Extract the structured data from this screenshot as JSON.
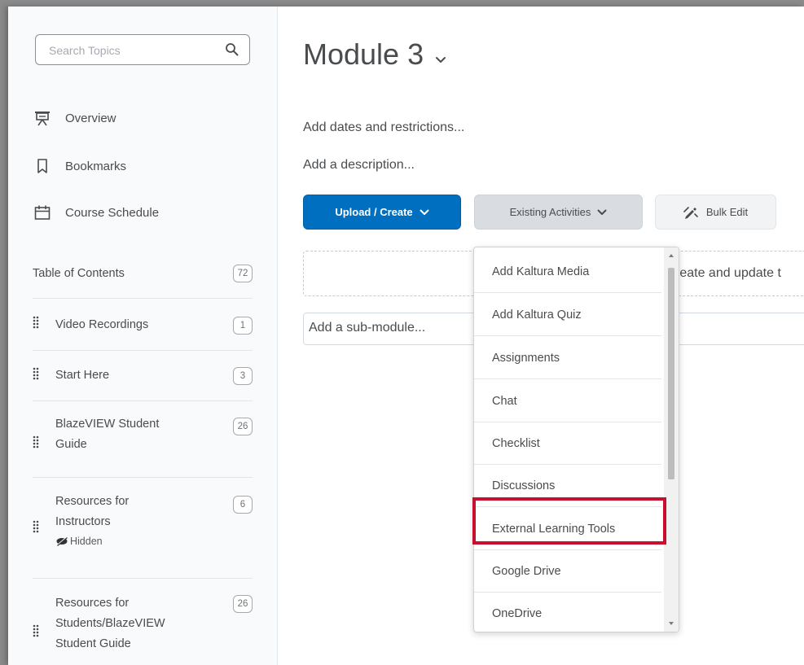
{
  "sidebar": {
    "search_placeholder": "Search Topics",
    "nav": [
      {
        "label": "Overview",
        "icon": "presentation-icon"
      },
      {
        "label": "Bookmarks",
        "icon": "bookmark-icon"
      },
      {
        "label": "Course Schedule",
        "icon": "calendar-icon"
      }
    ],
    "toc": {
      "label": "Table of Contents",
      "count": "72"
    },
    "modules": [
      {
        "lines": [
          "Video Recordings"
        ],
        "count": "1"
      },
      {
        "lines": [
          "Start Here"
        ],
        "count": "3"
      },
      {
        "lines": [
          "BlazeVIEW Student",
          "Guide"
        ],
        "count": "26"
      },
      {
        "lines": [
          "Resources for",
          "Instructors"
        ],
        "count": "6",
        "hidden_label": "Hidden"
      },
      {
        "lines": [
          "Resources for",
          "Students/BlazeVIEW",
          "Student Guide"
        ],
        "count": "26"
      }
    ]
  },
  "main": {
    "title": "Module 3",
    "add_dates": "Add dates and restrictions...",
    "add_description": "Add a description...",
    "buttons": {
      "upload": "Upload / Create",
      "existing": "Existing Activities",
      "bulk": "Bulk Edit"
    },
    "dropzone_text": "reate and update t",
    "submodule_placeholder": "Add a sub-module..."
  },
  "menu": {
    "items": [
      "Add Kaltura Media",
      "Add Kaltura Quiz",
      "Assignments",
      "Chat",
      "Checklist",
      "Discussions",
      "External Learning Tools",
      "Google Drive",
      "OneDrive"
    ],
    "highlighted": "External Learning Tools"
  },
  "colors": {
    "primary": "#006fbf",
    "highlight": "#c8102e"
  }
}
